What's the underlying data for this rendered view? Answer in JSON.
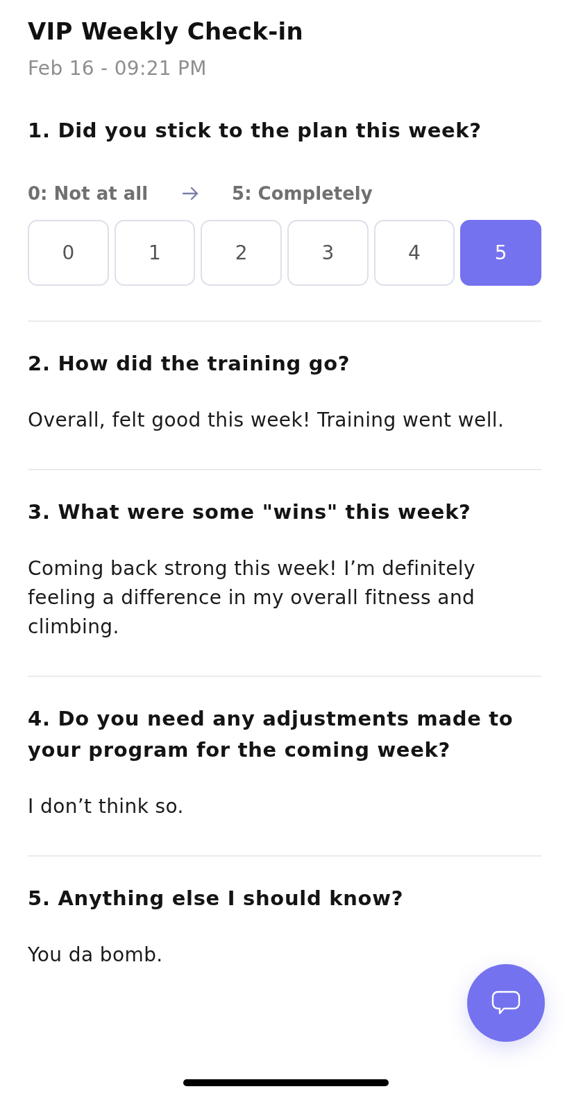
{
  "header": {
    "title": "VIP Weekly Check-in",
    "timestamp": "Feb 16 - 09:21 PM"
  },
  "questions": [
    {
      "kind": "scale",
      "question": "1. Did you stick to the plan this week?",
      "min_label": "0: Not at all",
      "max_label": "5: Completely",
      "options": [
        {
          "label": "0",
          "selected": false
        },
        {
          "label": "1",
          "selected": false
        },
        {
          "label": "2",
          "selected": false
        },
        {
          "label": "3",
          "selected": false
        },
        {
          "label": "4",
          "selected": false
        },
        {
          "label": "5",
          "selected": true
        }
      ]
    },
    {
      "kind": "text",
      "question": "2. How did the training go?",
      "answer": "Overall, felt good this week! Training went well."
    },
    {
      "kind": "text",
      "question": "3. What were some \"wins\" this week?",
      "answer": "Coming back strong this week! I’m definitely feeling a difference in my overall fitness and climbing."
    },
    {
      "kind": "text",
      "question": "4. Do you need any adjustments made to your program for the coming week?",
      "answer": "I don’t think so."
    },
    {
      "kind": "text",
      "question": "5. Anything else I should know?",
      "answer": "You da bomb."
    }
  ]
}
